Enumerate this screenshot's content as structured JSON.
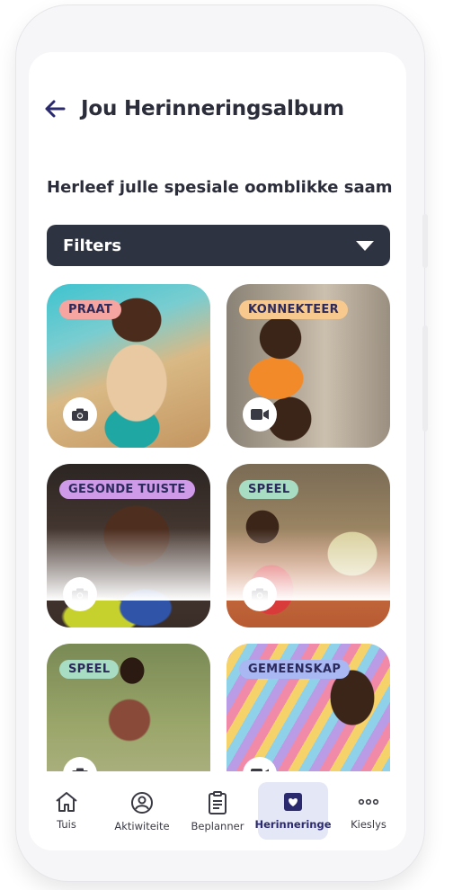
{
  "header": {
    "title": "Jou Herinneringsalbum",
    "back_icon": "arrow-left-icon"
  },
  "subtitle": "Herleef julle spesiale oomblikke saam",
  "filters": {
    "label": "Filters"
  },
  "colors": {
    "accent": "#2c2a6e",
    "filter_bar": "#2d3340",
    "tag_praat": "#f6a5a0",
    "tag_konnekteer": "#f7c98f",
    "tag_gesonde_tuiste": "#cf9be8",
    "tag_speel": "#a8dcc3",
    "tag_gemeenskap": "#a9b8f3"
  },
  "memories": [
    {
      "tag": "PRAAT",
      "media": "camera-icon"
    },
    {
      "tag": "KONNEKTEER",
      "media": "video-icon"
    },
    {
      "tag": "GESONDE TUISTE",
      "media": "camera-icon"
    },
    {
      "tag": "SPEEL",
      "media": "camera-icon"
    },
    {
      "tag": "SPEEL",
      "media": "camera-icon"
    },
    {
      "tag": "GEMEENSKAP",
      "media": "video-icon"
    }
  ],
  "nav": [
    {
      "label": "Tuis",
      "icon": "home-icon"
    },
    {
      "label": "Aktiwiteite",
      "icon": "activities-icon"
    },
    {
      "label": "Beplanner",
      "icon": "clipboard-icon"
    },
    {
      "label": "Herinneringe",
      "icon": "memories-heart-icon",
      "active": true
    },
    {
      "label": "Kieslys",
      "icon": "more-dots-icon"
    }
  ]
}
